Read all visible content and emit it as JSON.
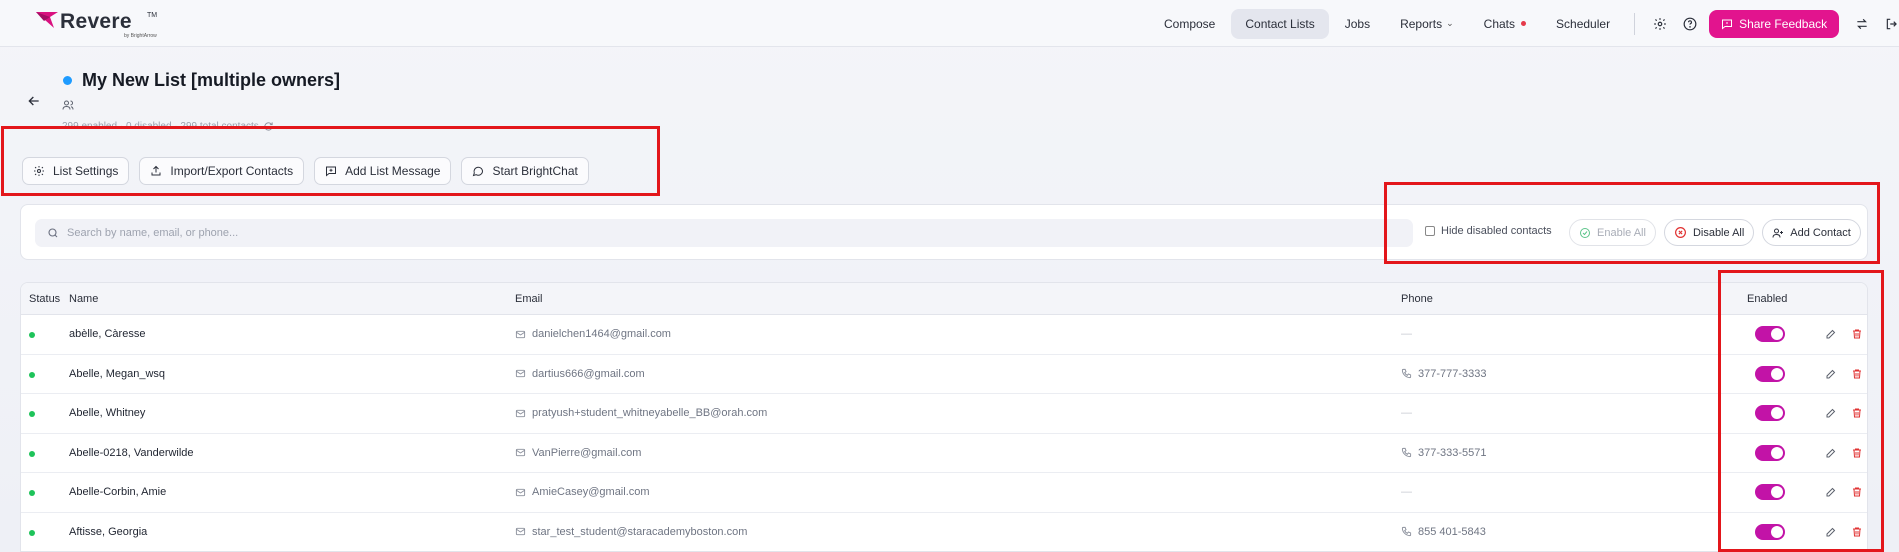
{
  "brand": {
    "name": "Revere",
    "tm": "TM",
    "sub": "by BrightArrow"
  },
  "nav": {
    "items": [
      {
        "label": "Compose"
      },
      {
        "label": "Contact Lists",
        "active": true
      },
      {
        "label": "Jobs"
      },
      {
        "label": "Reports",
        "dropdown": true
      },
      {
        "label": "Chats",
        "badge_dot": true
      },
      {
        "label": "Scheduler"
      }
    ],
    "share_feedback": "Share Feedback"
  },
  "header": {
    "title": "My New List [multiple owners]",
    "counts": "299 enabled · 0 disabled · 299 total contacts"
  },
  "actions": {
    "list_settings": "List Settings",
    "import_export": "Import/Export Contacts",
    "add_list_message": "Add List Message",
    "start_brightchat": "Start BrightChat"
  },
  "toolbar": {
    "search_placeholder": "Search by name, email, or phone...",
    "hide_disabled": "Hide disabled contacts",
    "enable_all": "Enable All",
    "disable_all": "Disable All",
    "add_contact": "Add Contact"
  },
  "table": {
    "columns": {
      "status": "Status",
      "name": "Name",
      "email": "Email",
      "phone": "Phone",
      "enabled": "Enabled"
    },
    "rows": [
      {
        "name": "abèlle, Càresse",
        "email": "danielchen1464@gmail.com",
        "phone": "—",
        "enabled": true
      },
      {
        "name": "Abelle, Megan_wsq",
        "email": "dartius666@gmail.com",
        "phone": "377-777-3333",
        "enabled": true
      },
      {
        "name": "Abelle, Whitney",
        "email": "pratyush+student_whitneyabelle_BB@orah.com",
        "phone": "—",
        "enabled": true
      },
      {
        "name": "Abelle-0218, Vanderwilde",
        "email": "VanPierre@gmail.com",
        "phone": "377-333-5571",
        "enabled": true
      },
      {
        "name": "Abelle-Corbin, Amie",
        "email": "AmieCasey@gmail.com",
        "phone": "—",
        "enabled": true
      },
      {
        "name": "Aftisse, Georgia",
        "email": "star_test_student@staracademyboston.com",
        "phone": "855 401-5843",
        "enabled": true
      }
    ]
  },
  "colors": {
    "accent": "#e2148e",
    "toggle_on": "#c213a7",
    "status_active": "#1ec35a",
    "delete": "#e03131",
    "highlight": "#e3161b"
  }
}
